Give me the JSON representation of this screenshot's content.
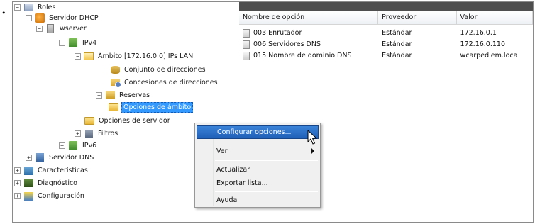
{
  "bullet": "•",
  "tree": {
    "roles": "Roles",
    "dhcp_server": "Servidor DHCP",
    "server": "wserver",
    "ipv4": "IPv4",
    "scope": "Ámbito [172.16.0.0] IPs LAN",
    "address_pool": "Conjunto de direcciones",
    "address_leases": "Concesiones de direcciones",
    "reservations": "Reservas",
    "scope_options": "Opciones de ámbito",
    "server_options": "Opciones de servidor",
    "filters": "Filtros",
    "ipv6": "IPv6",
    "dns_server": "Servidor DNS",
    "features": "Características",
    "diagnostics": "Diagnóstico",
    "configuration": "Configuración"
  },
  "list": {
    "columns": [
      "Nombre de opción",
      "Proveedor",
      "Valor"
    ],
    "rows": [
      {
        "name": "003 Enrutador",
        "vendor": "Estándar",
        "value": "172.16.0.1"
      },
      {
        "name": "006 Servidores DNS",
        "vendor": "Estándar",
        "value": "172.16.0.110"
      },
      {
        "name": "015 Nombre de dominio DNS",
        "vendor": "Estándar",
        "value": "wcarpediem.loca"
      }
    ]
  },
  "context_menu": {
    "configure": "Configurar opciones...",
    "view": "Ver",
    "refresh": "Actualizar",
    "export": "Exportar lista...",
    "help": "Ayuda"
  }
}
